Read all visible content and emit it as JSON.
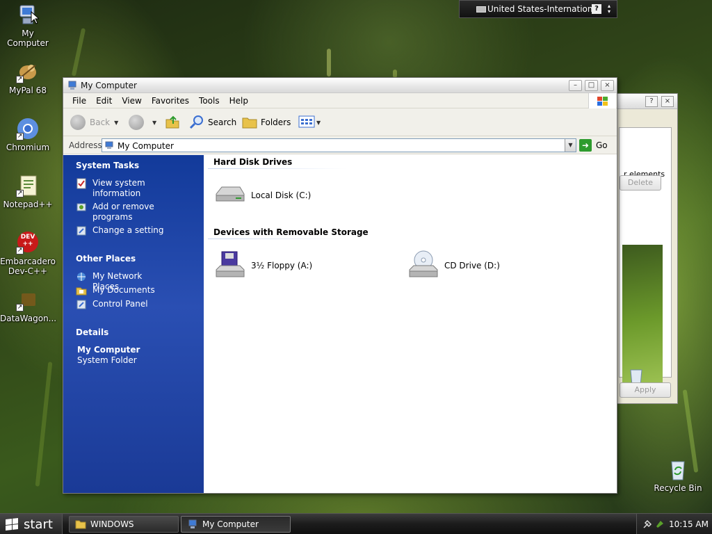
{
  "desktop": {
    "icons": [
      {
        "label": "My Computer",
        "icon": "my-computer-icon"
      },
      {
        "label": "MyPal 68",
        "icon": "mypal-icon"
      },
      {
        "label": "Chromium",
        "icon": "chromium-icon"
      },
      {
        "label": "Notepad++",
        "icon": "notepadpp-icon"
      },
      {
        "label": "Embarcadero Dev-C++",
        "icon": "devcpp-icon",
        "badge": "DEV ++"
      },
      {
        "label": "DataWagon...",
        "icon": "datawagon-icon"
      },
      {
        "label": "Recycle Bin",
        "icon": "recycle-bin-icon"
      }
    ]
  },
  "language_bar": {
    "label": "United States-International",
    "help": "?"
  },
  "background_dialog": {
    "elements_text": "r elements",
    "delete_label": "Delete",
    "apply_label": "Apply",
    "help_btn": "?",
    "close_btn": "×"
  },
  "window": {
    "title": "My Computer",
    "controls": {
      "minimize": "–",
      "maximize": "□",
      "close": "×"
    },
    "menu": [
      "File",
      "Edit",
      "View",
      "Favorites",
      "Tools",
      "Help"
    ],
    "toolbar": {
      "back": "Back",
      "search": "Search",
      "folders": "Folders"
    },
    "address": {
      "label": "Address",
      "value": "My Computer",
      "go": "Go"
    },
    "task_pane": {
      "system_tasks": {
        "title": "System Tasks",
        "items": [
          "View system information",
          "Add or remove programs",
          "Change a setting"
        ]
      },
      "other_places": {
        "title": "Other Places",
        "items": [
          "My Network Places",
          "My Documents",
          "Control Panel"
        ]
      },
      "details": {
        "title": "Details",
        "name": "My Computer",
        "type": "System Folder"
      }
    },
    "content": {
      "groups": [
        {
          "title": "Hard Disk Drives",
          "items": [
            {
              "label": "Local Disk (C:)",
              "icon": "hard-disk-icon"
            }
          ]
        },
        {
          "title": "Devices with Removable Storage",
          "items": [
            {
              "label": "3½ Floppy (A:)",
              "icon": "floppy-drive-icon"
            },
            {
              "label": "CD Drive (D:)",
              "icon": "cd-drive-icon"
            }
          ]
        }
      ]
    }
  },
  "taskbar": {
    "start": "start",
    "buttons": [
      {
        "label": "WINDOWS",
        "icon": "folder-icon"
      },
      {
        "label": "My Computer",
        "icon": "my-computer-icon"
      }
    ],
    "clock": "10:15 AM"
  }
}
